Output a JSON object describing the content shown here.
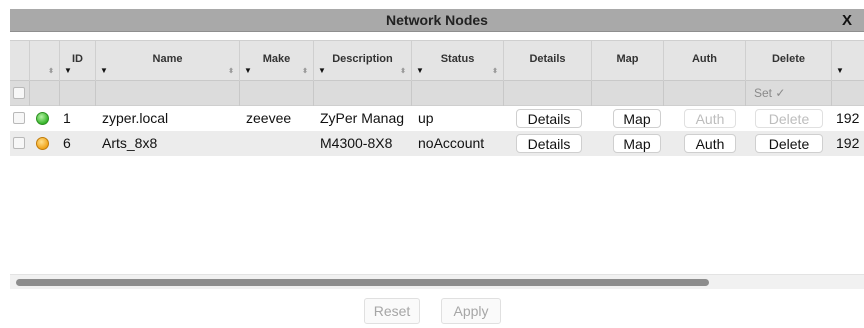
{
  "window": {
    "title": "Network Nodes",
    "close_label": "X"
  },
  "columns": {
    "id": "ID",
    "name": "Name",
    "make": "Make",
    "description": "Description",
    "status": "Status",
    "details": "Details",
    "map": "Map",
    "auth": "Auth",
    "delete": "Delete"
  },
  "filter": {
    "set_label": "Set ✓"
  },
  "rows": [
    {
      "id": "1",
      "status_color": "green",
      "name": "zyper.local",
      "make": "zeevee",
      "description": "ZyPer Manag",
      "status": "up",
      "details_label": "Details",
      "map_label": "Map",
      "auth_label": "Auth",
      "delete_label": "Delete",
      "auth_enabled": false,
      "delete_enabled": false,
      "ip": "192"
    },
    {
      "id": "6",
      "status_color": "orange",
      "name": "Arts_8x8",
      "make": "",
      "description": "M4300-8X8",
      "status": "noAccount",
      "details_label": "Details",
      "map_label": "Map",
      "auth_label": "Auth",
      "delete_label": "Delete",
      "auth_enabled": true,
      "delete_enabled": true,
      "ip": "192"
    }
  ],
  "footer": {
    "reset_label": "Reset",
    "apply_label": "Apply"
  }
}
